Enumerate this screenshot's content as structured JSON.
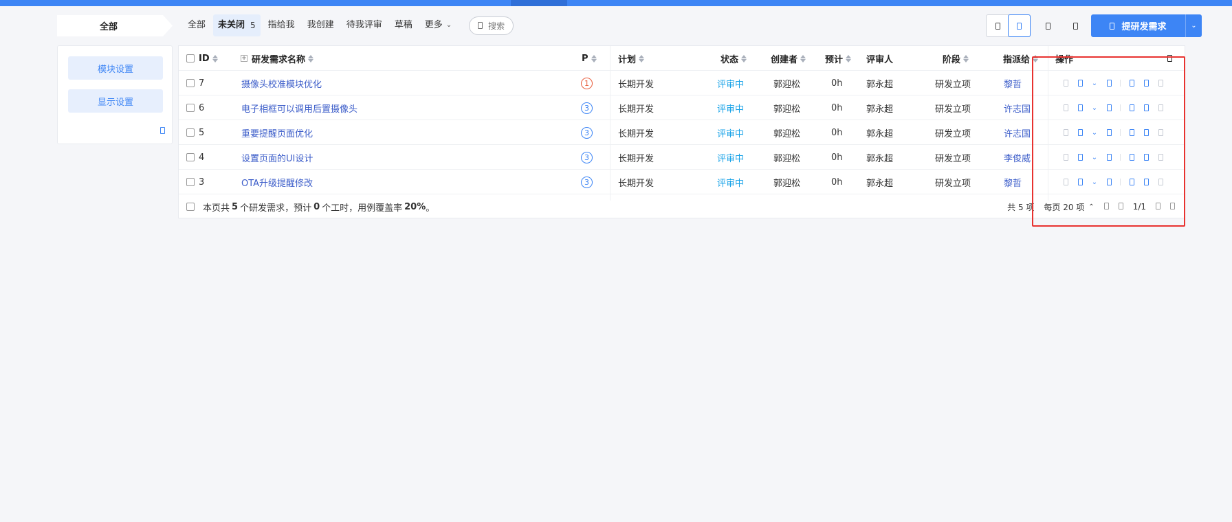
{
  "scope_tab": "全部",
  "filter_tabs": [
    {
      "label": "全部",
      "active": false
    },
    {
      "label": "未关闭",
      "active": true,
      "count": "5"
    },
    {
      "label": "指给我",
      "active": false
    },
    {
      "label": "我创建",
      "active": false
    },
    {
      "label": "待我评审",
      "active": false
    },
    {
      "label": "草稿",
      "active": false
    },
    {
      "label": "更多",
      "active": false
    }
  ],
  "search": {
    "label": "搜索",
    "icon": "search-icon"
  },
  "toolbar": {
    "create_label": "提研发需求",
    "icons": [
      "list-view-icon",
      "tree-view-icon",
      "export-icon",
      "import-icon"
    ]
  },
  "side_panel": {
    "module_settings": "模块设置",
    "display_settings": "显示设置"
  },
  "table": {
    "columns": {
      "id": "ID",
      "name": "研发需求名称",
      "priority": "P",
      "plan": "计划",
      "status": "状态",
      "creator": "创建者",
      "estimate": "预计",
      "reviewer": "评审人",
      "stage": "阶段",
      "assignee": "指派给",
      "actions": "操作"
    },
    "rows": [
      {
        "id": "7",
        "name": "摄像头校准模块优化",
        "priority": "1",
        "plan": "长期开发",
        "status": "评审中",
        "creator": "郭迎松",
        "estimate": "0h",
        "reviewer": "郭永超",
        "stage": "研发立项",
        "assignee": "黎哲"
      },
      {
        "id": "6",
        "name": "电子相框可以调用后置摄像头",
        "priority": "3",
        "plan": "长期开发",
        "status": "评审中",
        "creator": "郭迎松",
        "estimate": "0h",
        "reviewer": "郭永超",
        "stage": "研发立项",
        "assignee": "许志国"
      },
      {
        "id": "5",
        "name": "重要提醒页面优化",
        "priority": "3",
        "plan": "长期开发",
        "status": "评审中",
        "creator": "郭迎松",
        "estimate": "0h",
        "reviewer": "郭永超",
        "stage": "研发立项",
        "assignee": "许志国"
      },
      {
        "id": "4",
        "name": "设置页面的UI设计",
        "priority": "3",
        "plan": "长期开发",
        "status": "评审中",
        "creator": "郭迎松",
        "estimate": "0h",
        "reviewer": "郭永超",
        "stage": "研发立项",
        "assignee": "李俊威"
      },
      {
        "id": "3",
        "name": "OTA升级提醒修改",
        "priority": "3",
        "plan": "长期开发",
        "status": "评审中",
        "creator": "郭迎松",
        "estimate": "0h",
        "reviewer": "郭永超",
        "stage": "研发立项",
        "assignee": "黎哲"
      }
    ]
  },
  "footer": {
    "summary_pre": "本页共",
    "count": "5",
    "summary_mid1": "个研发需求，预计",
    "hours": "0",
    "summary_mid2": "个工时，用例覆盖率",
    "coverage": "20%",
    "summary_end": "。",
    "total": "共 5 项",
    "per_page": "每页 20 项",
    "page": "1/1"
  }
}
